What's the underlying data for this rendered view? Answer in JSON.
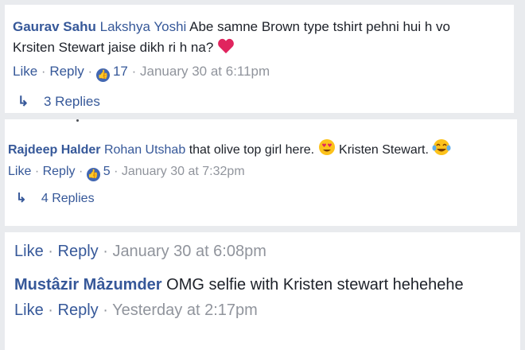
{
  "comments": [
    {
      "author": "Gaurav Sahu",
      "mention": "Lakshya Yoshi",
      "text_line1": "Abe samne Brown type tshirt pehni hui h vo",
      "text_line2": "Krsiten Stewart jaise dikh ri h na?",
      "emoji": "heart-icon",
      "like_label": "Like",
      "sep": "·",
      "reply_label": "Reply",
      "likes": "17",
      "time": "January 30 at 6:11pm",
      "replies": "3 Replies"
    },
    {
      "author": "Rajdeep Halder",
      "mention": "Rohan Utshab",
      "text": "that olive top girl here.",
      "text2": "Kristen Stewart.",
      "emoji1": "heart-eyes-emoji-icon",
      "emoji2": "laughing-tears-emoji-icon",
      "like_label": "Like",
      "sep": "·",
      "reply_label": "Reply",
      "likes": "5",
      "time": "January 30 at 7:32pm",
      "replies": "4 Replies"
    },
    {
      "like_label": "Like",
      "sep": "·",
      "reply_label": "Reply",
      "time": "January 30 at 6:08pm"
    },
    {
      "author": "Mustâzir Mâzumder",
      "text": "OMG selfie with Kristen stewart hehehehe",
      "like_label": "Like",
      "sep": "·",
      "reply_label": "Reply",
      "time": "Yesterday at 2:17pm"
    }
  ],
  "colors": {
    "link": "#365899",
    "meta": "#90949c",
    "text": "#1d2129",
    "like_badge": "#4267b2",
    "background": "#e9ebee"
  }
}
